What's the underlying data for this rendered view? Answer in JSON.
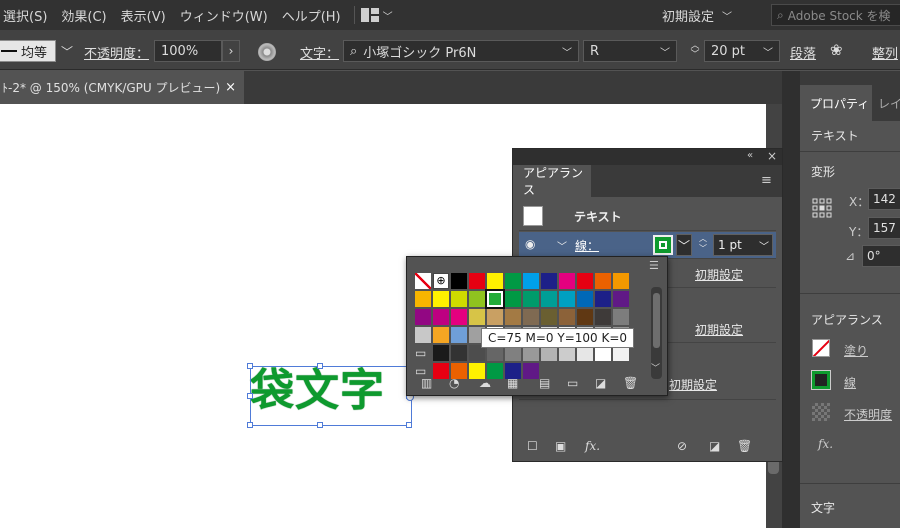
{
  "menu": {
    "items": [
      "選択(S)",
      "効果(C)",
      "表示(V)",
      "ウィンドウ(W)",
      "ヘルプ(H)"
    ],
    "workspace": "初期設定",
    "stock_search_placeholder": "Adobe Stock を検"
  },
  "control": {
    "stroke_profile": "均等",
    "opacity_label": "不透明度：",
    "opacity_value": "100%",
    "char_label": "文字：",
    "font_family": "小塚ゴシック Pr6N",
    "font_style": "R",
    "font_size": "20 pt",
    "paragraph_label": "段落",
    "align_label": "整列"
  },
  "doc_tab": {
    "title": "ﾄ-2* @ 150% (CMYK/GPU プレビュー)",
    "close": "×"
  },
  "artwork": {
    "text": "袋文字",
    "color": "#0e9a2e"
  },
  "properties": {
    "tab_active": "プロパティ",
    "tab_other": "レイ",
    "type_label": "テキスト",
    "transform_label": "変形",
    "x_label": "X：",
    "x_value": "142",
    "y_label": "Y：",
    "y_value": "157",
    "angle_value": "0°",
    "appearance_label": "アピアランス",
    "fill_label": "塗り",
    "stroke_label": "線",
    "opacity_label": "不透明度",
    "fx_label": "fx.",
    "char_label": "文字"
  },
  "appearance": {
    "tab": "アピアランス",
    "object_label": "テキスト",
    "stroke_label": "線：",
    "stroke_weight": "1 pt",
    "rows": [
      "初期設定",
      "初期設定",
      "初期設定"
    ],
    "fx": "fx."
  },
  "swatches": {
    "tooltip": "C=75 M=0 Y=100 K=0",
    "colors": [
      [
        "#ffffff",
        "#ffffff",
        "#000000",
        "#e60012",
        "#fff100",
        "#009944",
        "#00a0e9",
        "#1d2088",
        "#e4007f",
        "#e60012",
        "#eb6100",
        "#f39800"
      ],
      [
        "#f8b500",
        "#fff100",
        "#cfdb00",
        "#8fc31f",
        "#22ac38",
        "#009944",
        "#009b6b",
        "#009e96",
        "#00a0c1",
        "#0068b7",
        "#1d2088",
        "#601986"
      ],
      [
        "#920783",
        "#be0081",
        "#e4007f",
        "#d7c447",
        "#c9a063",
        "#a37a44",
        "#7f6a52",
        "#6a5f31",
        "#8c6239",
        "#603813",
        "#3e3a39",
        "#7d7d7d"
      ],
      [
        "#c8c8c8",
        "#f5a623",
        "#6f9fd8",
        "#a0a0a0",
        "#ffffff",
        "#888888",
        "#bdbdbd",
        "#d9d9d9",
        "#eeeeee",
        "#cccccc",
        "#b3b3b3",
        "#999999"
      ],
      [
        "#5a5a5a",
        "#1a1a1a",
        "#333333",
        "#4d4d4d",
        "#666666",
        "#808080",
        "#999999",
        "#b3b3b3",
        "#cccccc",
        "#e6e6e6",
        "#ffffff",
        "#f2f2f2"
      ],
      [
        "#5a5a5a",
        "#e60012",
        "#eb6100",
        "#fff100",
        "#009944",
        "#1d2088",
        "#601986",
        "#535353",
        "#535353",
        "#535353",
        "#535353",
        "#535353"
      ]
    ]
  }
}
